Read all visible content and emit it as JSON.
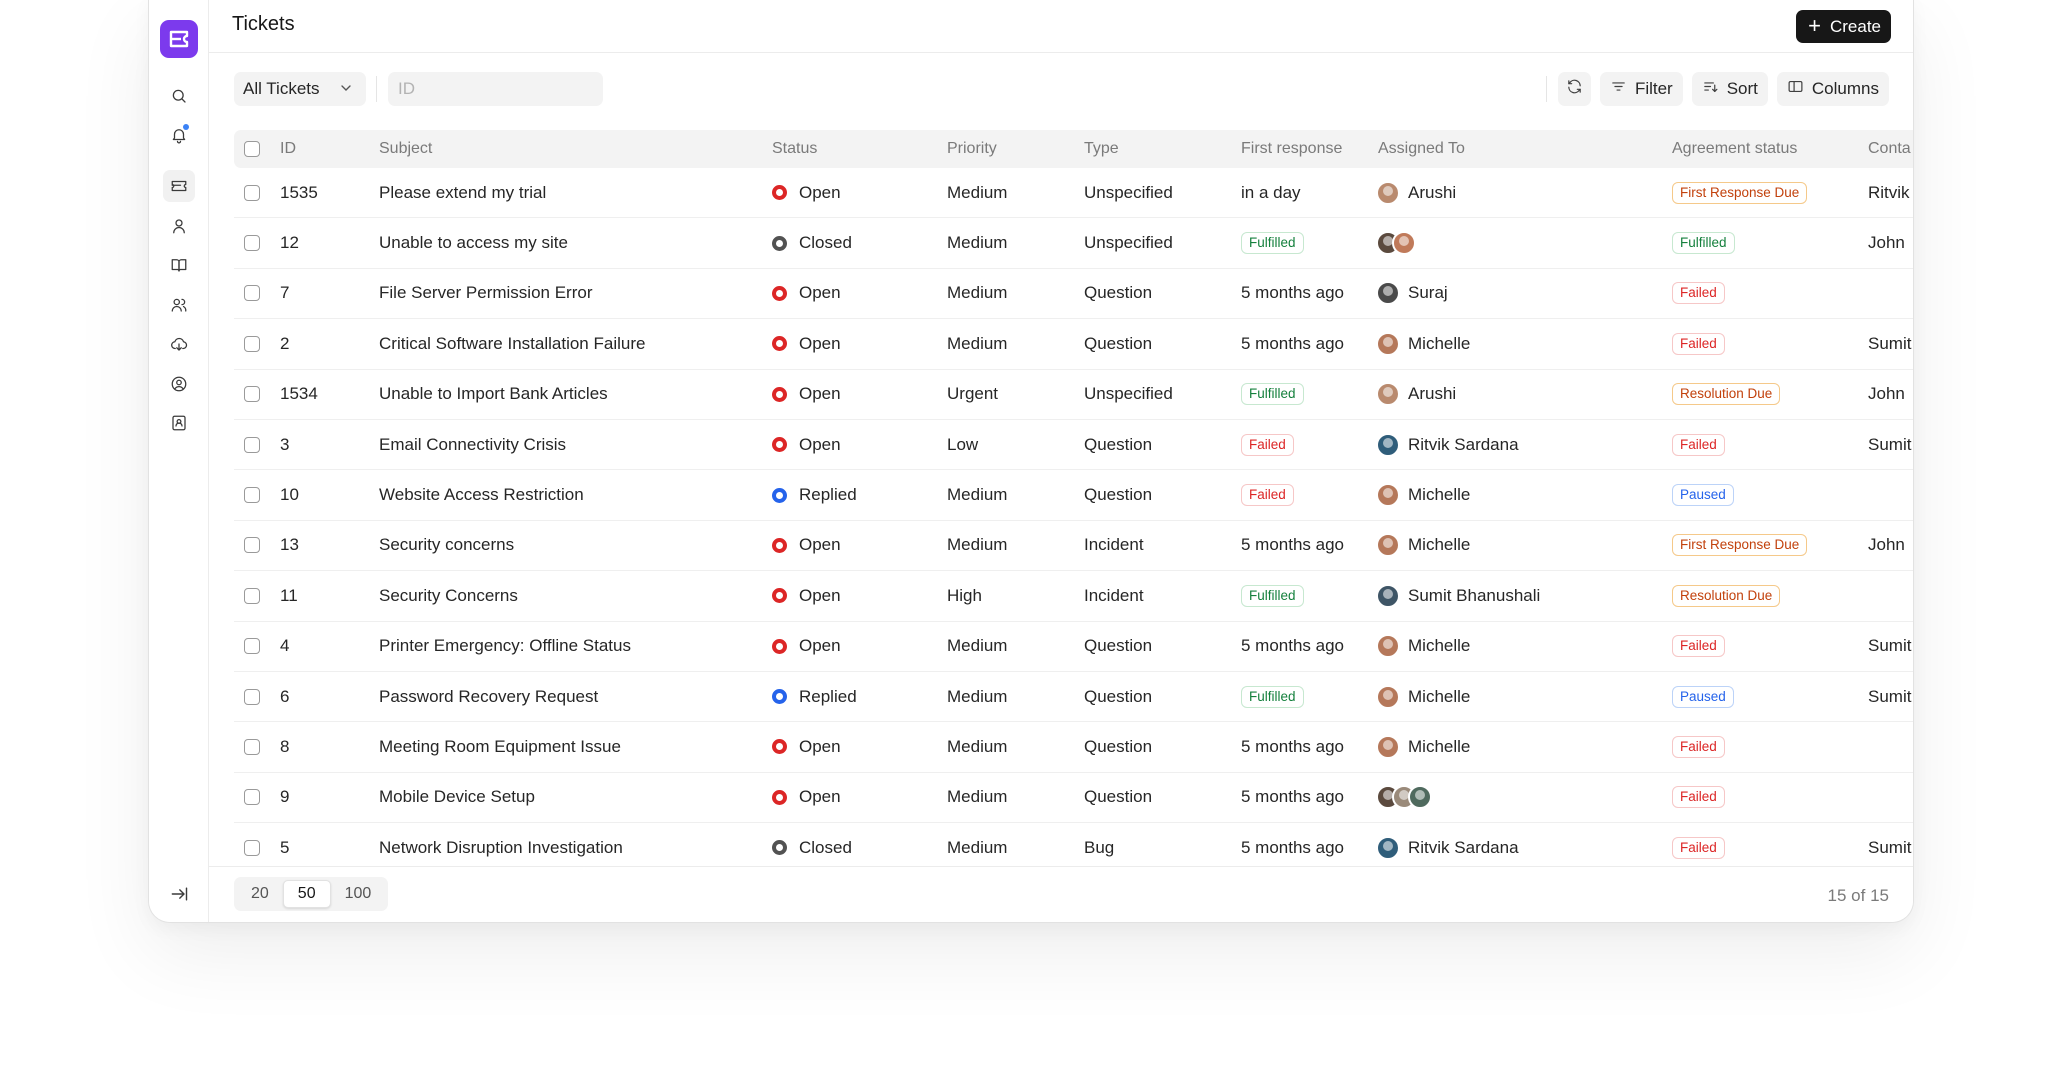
{
  "header": {
    "title": "Tickets",
    "create_label": "Create"
  },
  "toolbar": {
    "view_select": "All Tickets",
    "id_placeholder": "ID",
    "filter_label": "Filter",
    "sort_label": "Sort",
    "columns_label": "Columns"
  },
  "sidebar": {
    "icons": [
      "search-icon",
      "bell-icon",
      "ticket-icon",
      "user-icon",
      "book-icon",
      "users-icon",
      "cloud-icon",
      "user-circle-icon",
      "contact-card-icon"
    ],
    "active": "ticket-icon",
    "collapse_icon": "arrow-right-bar-icon"
  },
  "table": {
    "columns": {
      "id": "ID",
      "subject": "Subject",
      "status": "Status",
      "priority": "Priority",
      "type": "Type",
      "first_response": "First response",
      "assigned": "Assigned To",
      "agreement": "Agreement status",
      "contact": "Conta"
    },
    "rows": [
      {
        "id": "1535",
        "subject": "Please extend my trial",
        "status": "Open",
        "priority": "Medium",
        "type": "Unspecified",
        "first_response": "in a day",
        "response_badge": false,
        "assigned": "Arushi",
        "avatars": [
          "#b98a6e"
        ],
        "agreement": "First Response Due",
        "agreement_color": "orange",
        "contact": "Ritvik"
      },
      {
        "id": "12",
        "subject": "Unable to access my site",
        "status": "Closed",
        "priority": "Medium",
        "type": "Unspecified",
        "first_response": "Fulfilled",
        "response_badge": "green",
        "assigned": "",
        "avatars": [
          "#5b4a3e",
          "#c07a5a"
        ],
        "agreement": "Fulfilled",
        "agreement_color": "green",
        "contact": "John"
      },
      {
        "id": "7",
        "subject": "File Server Permission Error",
        "status": "Open",
        "priority": "Medium",
        "type": "Question",
        "first_response": "5 months ago",
        "response_badge": false,
        "assigned": "Suraj",
        "avatars": [
          "#4a4a4a"
        ],
        "agreement": "Failed",
        "agreement_color": "red",
        "contact": ""
      },
      {
        "id": "2",
        "subject": "Critical Software Installation Failure",
        "status": "Open",
        "priority": "Medium",
        "type": "Question",
        "first_response": "5 months ago",
        "response_badge": false,
        "assigned": "Michelle",
        "avatars": [
          "#b5785a"
        ],
        "agreement": "Failed",
        "agreement_color": "red",
        "contact": "Sumit"
      },
      {
        "id": "1534",
        "subject": "Unable to Import Bank Articles",
        "status": "Open",
        "priority": "Urgent",
        "type": "Unspecified",
        "first_response": "Fulfilled",
        "response_badge": "green",
        "assigned": "Arushi",
        "avatars": [
          "#b98a6e"
        ],
        "agreement": "Resolution Due",
        "agreement_color": "orange",
        "contact": "John"
      },
      {
        "id": "3",
        "subject": "Email Connectivity Crisis",
        "status": "Open",
        "priority": "Low",
        "type": "Question",
        "first_response": "Failed",
        "response_badge": "red",
        "assigned": "Ritvik Sardana",
        "avatars": [
          "#2f5d7a"
        ],
        "agreement": "Failed",
        "agreement_color": "red",
        "contact": "Sumit"
      },
      {
        "id": "10",
        "subject": "Website Access Restriction",
        "status": "Replied",
        "priority": "Medium",
        "type": "Question",
        "first_response": "Failed",
        "response_badge": "red",
        "assigned": "Michelle",
        "avatars": [
          "#b5785a"
        ],
        "agreement": "Paused",
        "agreement_color": "blue",
        "contact": ""
      },
      {
        "id": "13",
        "subject": "Security concerns",
        "status": "Open",
        "priority": "Medium",
        "type": "Incident",
        "first_response": "5 months ago",
        "response_badge": false,
        "assigned": "Michelle",
        "avatars": [
          "#b5785a"
        ],
        "agreement": "First Response Due",
        "agreement_color": "orange",
        "contact": "John"
      },
      {
        "id": "11",
        "subject": "Security Concerns",
        "status": "Open",
        "priority": "High",
        "type": "Incident",
        "first_response": "Fulfilled",
        "response_badge": "green",
        "assigned": "Sumit Bhanushali",
        "avatars": [
          "#3e5566"
        ],
        "agreement": "Resolution Due",
        "agreement_color": "orange",
        "contact": ""
      },
      {
        "id": "4",
        "subject": "Printer Emergency: Offline Status",
        "status": "Open",
        "priority": "Medium",
        "type": "Question",
        "first_response": "5 months ago",
        "response_badge": false,
        "assigned": "Michelle",
        "avatars": [
          "#b5785a"
        ],
        "agreement": "Failed",
        "agreement_color": "red",
        "contact": "Sumit"
      },
      {
        "id": "6",
        "subject": "Password Recovery Request",
        "status": "Replied",
        "priority": "Medium",
        "type": "Question",
        "first_response": "Fulfilled",
        "response_badge": "green",
        "assigned": "Michelle",
        "avatars": [
          "#b5785a"
        ],
        "agreement": "Paused",
        "agreement_color": "blue",
        "contact": "Sumit"
      },
      {
        "id": "8",
        "subject": "Meeting Room Equipment Issue",
        "status": "Open",
        "priority": "Medium",
        "type": "Question",
        "first_response": "5 months ago",
        "response_badge": false,
        "assigned": "Michelle",
        "avatars": [
          "#b5785a"
        ],
        "agreement": "Failed",
        "agreement_color": "red",
        "contact": ""
      },
      {
        "id": "9",
        "subject": "Mobile Device Setup",
        "status": "Open",
        "priority": "Medium",
        "type": "Question",
        "first_response": "5 months ago",
        "response_badge": false,
        "assigned": "",
        "avatars": [
          "#5b4a3e",
          "#9a8a7a",
          "#4f6a5e"
        ],
        "agreement": "Failed",
        "agreement_color": "red",
        "contact": ""
      },
      {
        "id": "5",
        "subject": "Network Disruption Investigation",
        "status": "Closed",
        "priority": "Medium",
        "type": "Bug",
        "first_response": "5 months ago",
        "response_badge": false,
        "assigned": "Ritvik Sardana",
        "avatars": [
          "#2f5d7a"
        ],
        "agreement": "Failed",
        "agreement_color": "red",
        "contact": "Sumit"
      }
    ]
  },
  "footer": {
    "page_sizes": [
      "20",
      "50",
      "100"
    ],
    "active_page_size": "50",
    "count": "15 of 15"
  }
}
